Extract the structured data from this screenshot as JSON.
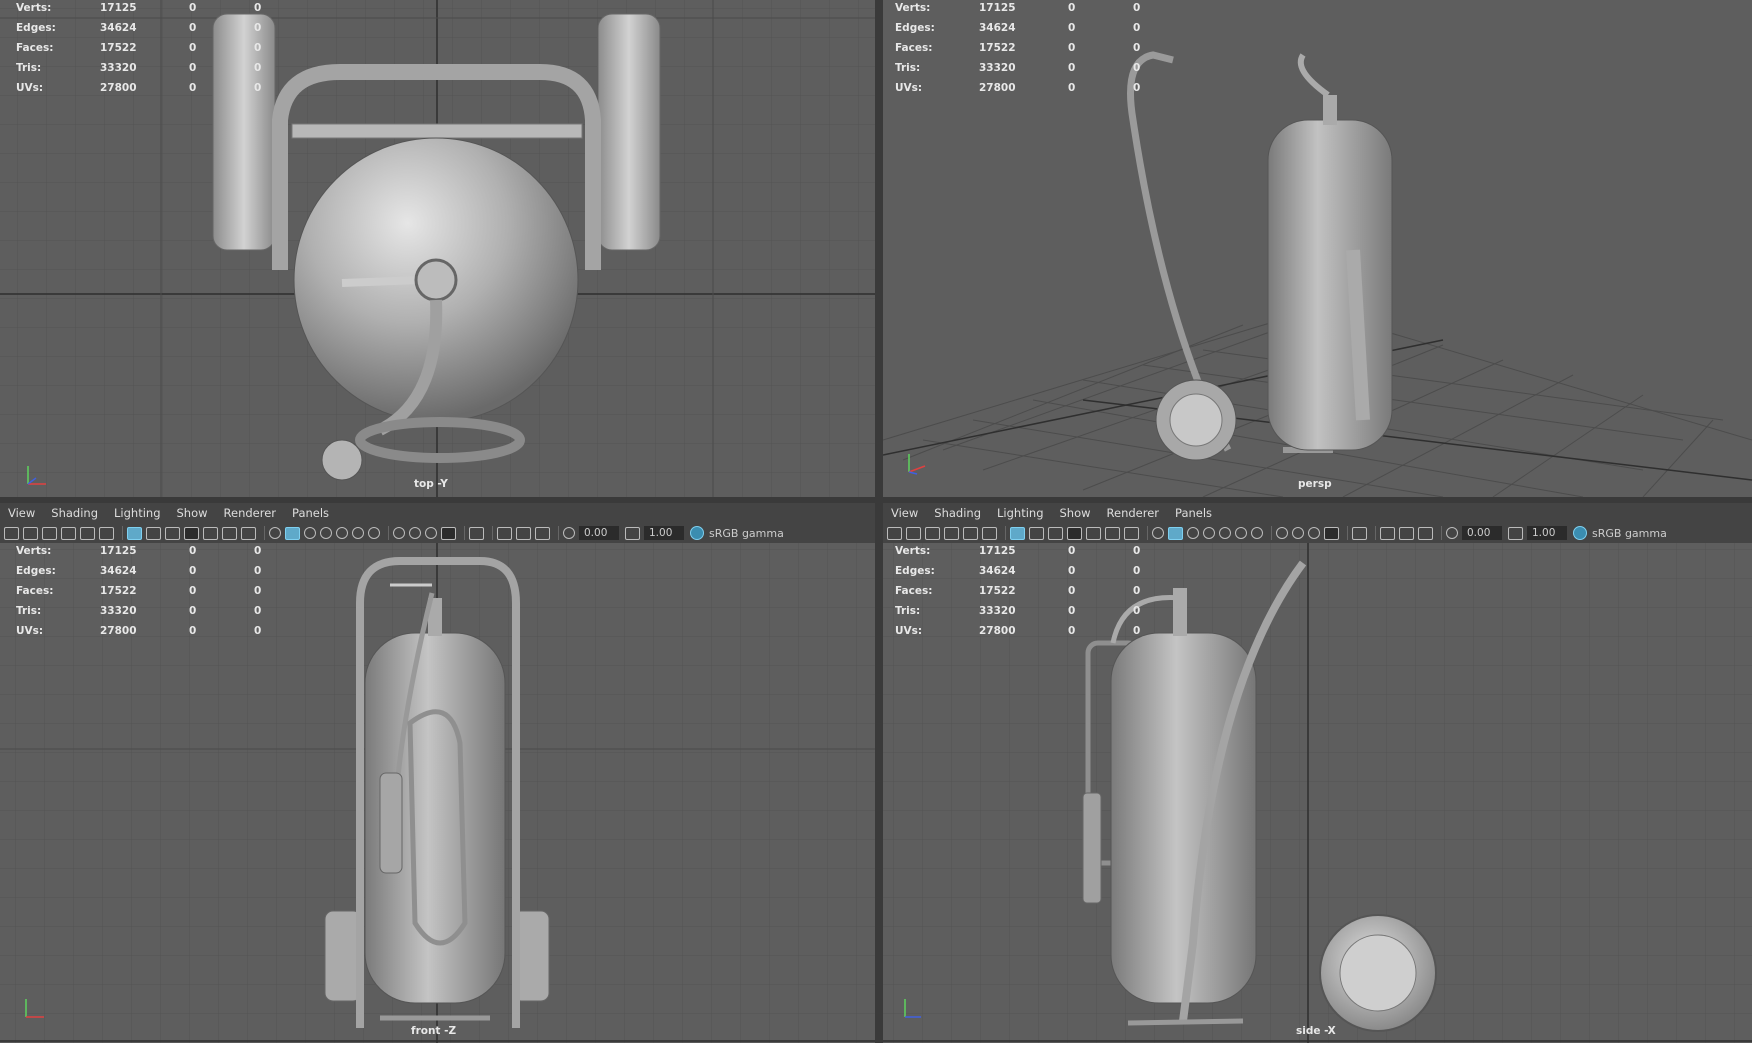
{
  "menus": [
    "View",
    "Shading",
    "Lighting",
    "Show",
    "Renderer",
    "Panels"
  ],
  "toolbar": {
    "exposure": "0.00",
    "gamma": "1.00",
    "color_space": "sRGB gamma"
  },
  "stats": [
    {
      "label": "Verts:",
      "v1": "17125",
      "v2": "0",
      "v3": "0"
    },
    {
      "label": "Edges:",
      "v1": "34624",
      "v2": "0",
      "v3": "0"
    },
    {
      "label": "Faces:",
      "v1": "17522",
      "v2": "0",
      "v3": "0"
    },
    {
      "label": "Tris:",
      "v1": "33320",
      "v2": "0",
      "v3": "0"
    },
    {
      "label": "UVs:",
      "v1": "27800",
      "v2": "0",
      "v3": "0"
    }
  ],
  "viewports": {
    "top": {
      "label": "top -Y"
    },
    "persp": {
      "label": "persp"
    },
    "front": {
      "label": "front -Z"
    },
    "side": {
      "label": "side -X"
    }
  },
  "icons": [
    "camera-icon",
    "grid-icon",
    "wireframe-icon",
    "smooth-shade-icon",
    "textured-icon",
    "light-icon",
    "isolate-icon",
    "xray-icon",
    "exposure-icon",
    "gamma-icon",
    "color-management-icon"
  ],
  "colors": {
    "viewport_bg": "#5e5e5e",
    "panel_bg": "#444444",
    "active_icon": "#5fa9c9",
    "stats_text": "#e8e8e8"
  }
}
